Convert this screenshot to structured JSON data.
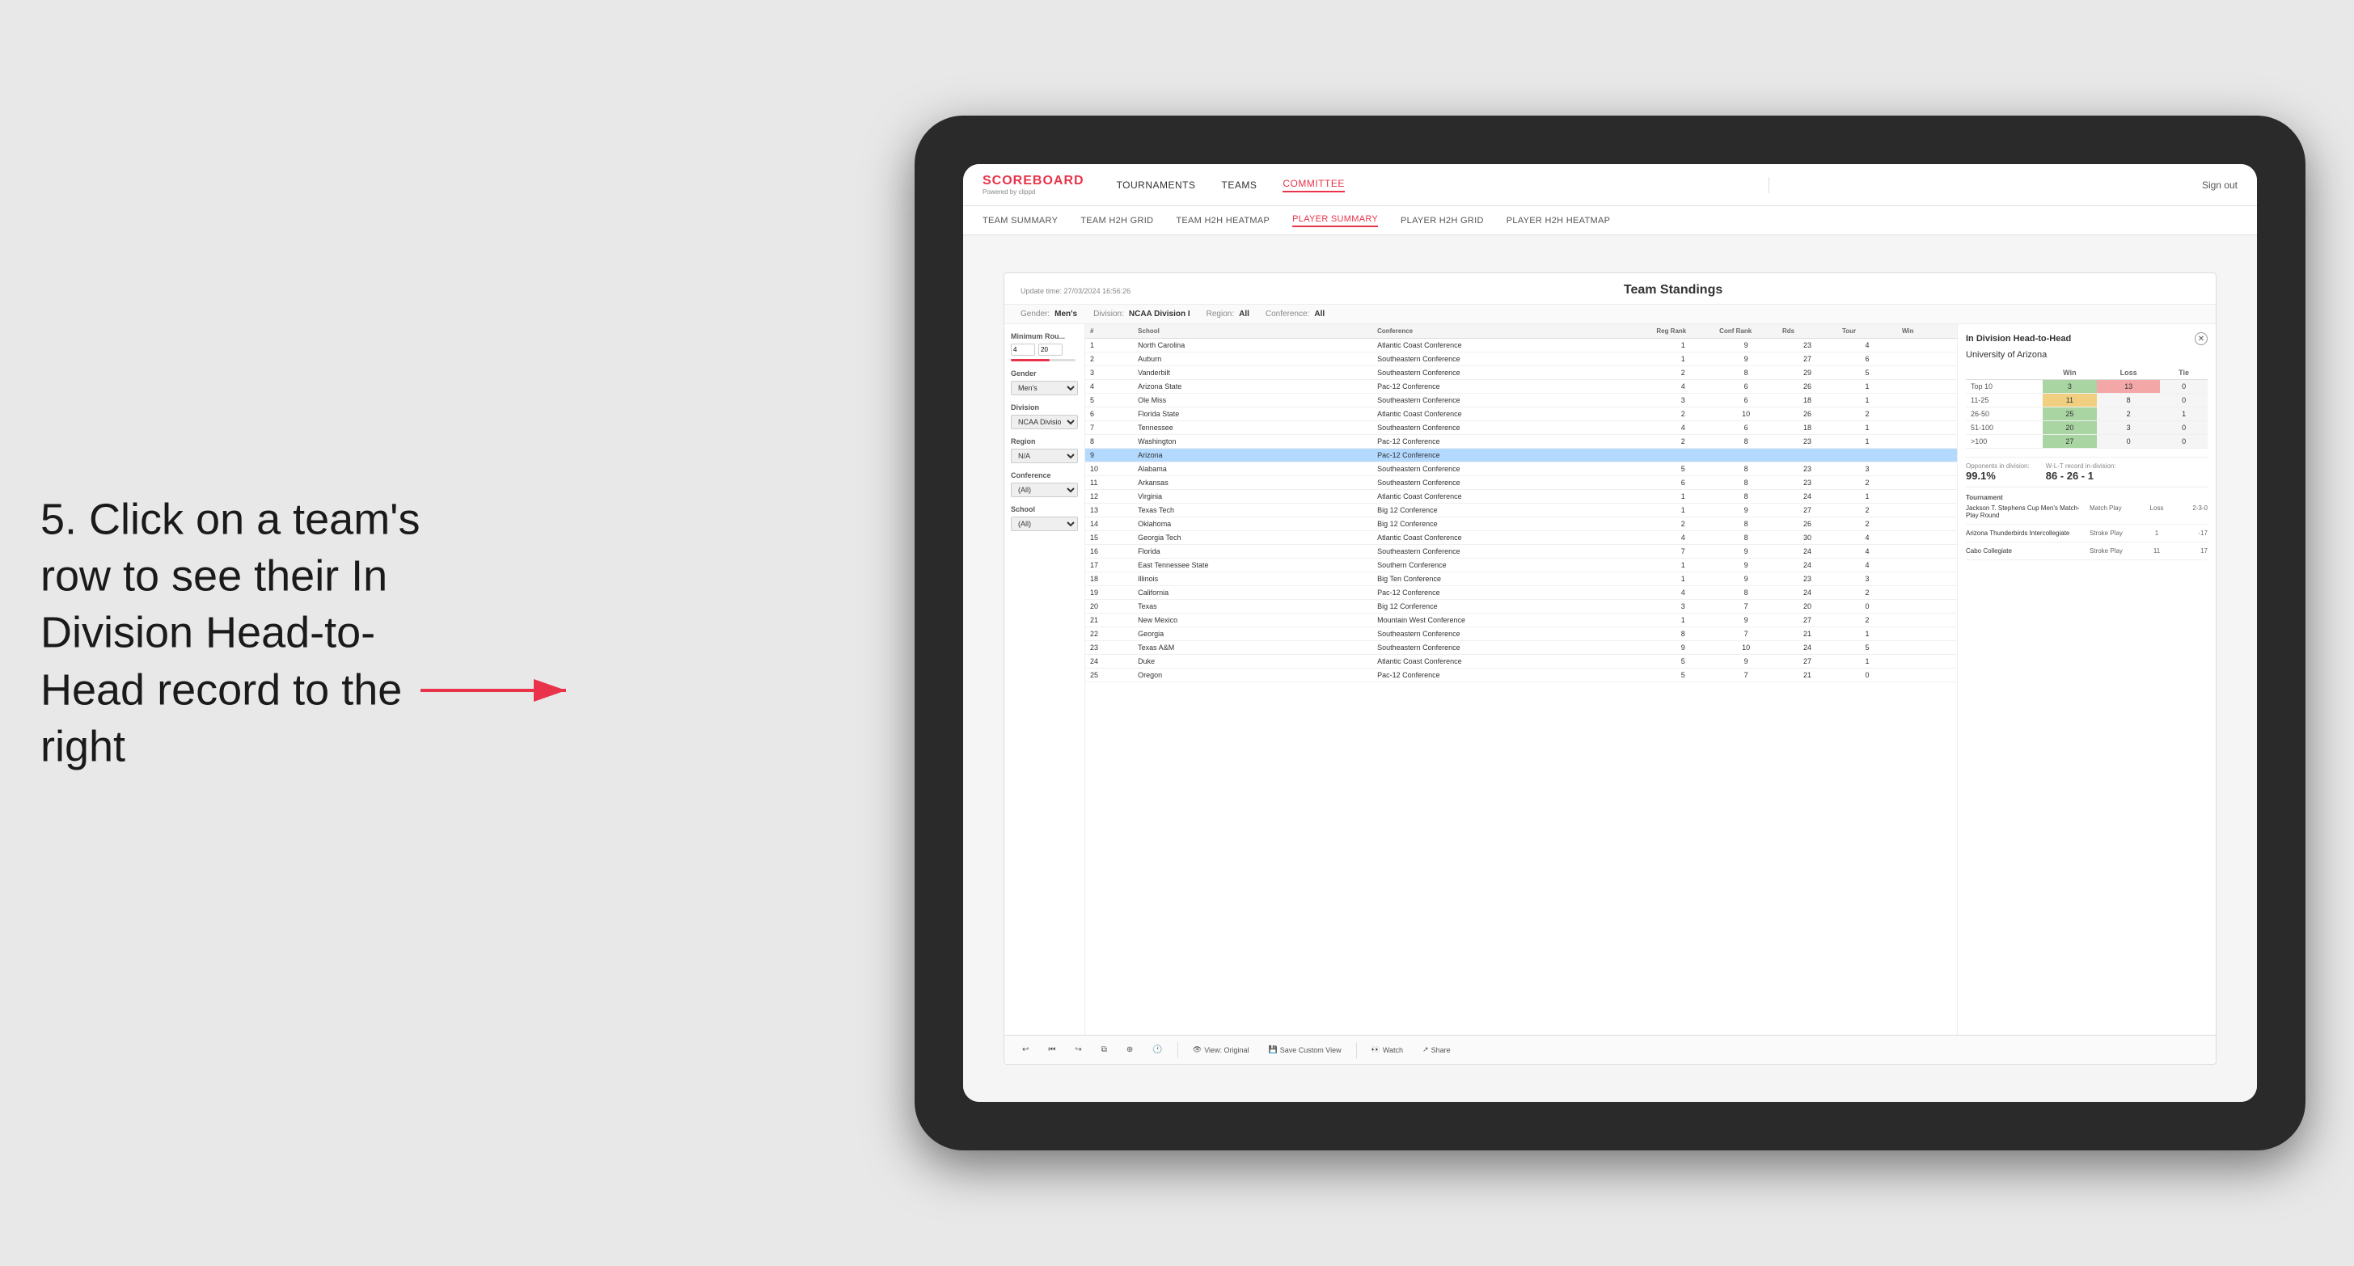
{
  "instruction": {
    "text": "5. Click on a team's row to see their In Division Head-to-Head record to the right"
  },
  "nav": {
    "logo": "SCOREBOARD",
    "logo_sub": "Powered by clippd",
    "links": [
      "TOURNAMENTS",
      "TEAMS",
      "COMMITTEE"
    ],
    "active_link": "COMMITTEE",
    "sign_out": "Sign out"
  },
  "sub_nav": {
    "links": [
      "TEAM SUMMARY",
      "TEAM H2H GRID",
      "TEAM H2H HEATMAP",
      "PLAYER SUMMARY",
      "PLAYER H2H GRID",
      "PLAYER H2H HEATMAP"
    ],
    "active": "PLAYER SUMMARY"
  },
  "dashboard": {
    "update_time": "Update time: 27/03/2024 16:56:26",
    "title": "Team Standings",
    "filters": {
      "gender": "Men's",
      "division": "NCAA Division I",
      "region": "All",
      "conference": "All"
    }
  },
  "sidebar": {
    "min_rounds_label": "Minimum Rou...",
    "min_rounds_value": "4",
    "min_rounds_max": "20",
    "gender_label": "Gender",
    "gender_value": "Men's",
    "division_label": "Division",
    "division_value": "NCAA Division I",
    "region_label": "Region",
    "region_value": "N/A",
    "conference_label": "Conference",
    "conference_value": "(All)",
    "school_label": "School",
    "school_value": "(All)"
  },
  "table": {
    "headers": [
      "#",
      "School",
      "Conference",
      "Reg Rank",
      "Conf Rank",
      "Rds",
      "Tour",
      "Win"
    ],
    "rows": [
      {
        "rank": 1,
        "school": "North Carolina",
        "conference": "Atlantic Coast Conference",
        "reg_rank": 1,
        "conf_rank": 9,
        "rds": 23,
        "tour": 4,
        "win": ""
      },
      {
        "rank": 2,
        "school": "Auburn",
        "conference": "Southeastern Conference",
        "reg_rank": 1,
        "conf_rank": 9,
        "rds": 27,
        "tour": 6,
        "win": ""
      },
      {
        "rank": 3,
        "school": "Vanderbilt",
        "conference": "Southeastern Conference",
        "reg_rank": 2,
        "conf_rank": 8,
        "rds": 29,
        "tour": 5,
        "win": ""
      },
      {
        "rank": 4,
        "school": "Arizona State",
        "conference": "Pac-12 Conference",
        "reg_rank": 4,
        "conf_rank": 6,
        "rds": 26,
        "tour": 1,
        "win": ""
      },
      {
        "rank": 5,
        "school": "Ole Miss",
        "conference": "Southeastern Conference",
        "reg_rank": 3,
        "conf_rank": 6,
        "rds": 18,
        "tour": 1,
        "win": ""
      },
      {
        "rank": 6,
        "school": "Florida State",
        "conference": "Atlantic Coast Conference",
        "reg_rank": 2,
        "conf_rank": 10,
        "rds": 26,
        "tour": 2,
        "win": ""
      },
      {
        "rank": 7,
        "school": "Tennessee",
        "conference": "Southeastern Conference",
        "reg_rank": 4,
        "conf_rank": 6,
        "rds": 18,
        "tour": 1,
        "win": ""
      },
      {
        "rank": 8,
        "school": "Washington",
        "conference": "Pac-12 Conference",
        "reg_rank": 2,
        "conf_rank": 8,
        "rds": 23,
        "tour": 1,
        "win": ""
      },
      {
        "rank": 9,
        "school": "Arizona",
        "conference": "Pac-12 Conference",
        "reg_rank": "",
        "conf_rank": "",
        "rds": "",
        "tour": "",
        "win": "",
        "highlighted": true
      },
      {
        "rank": 10,
        "school": "Alabama",
        "conference": "Southeastern Conference",
        "reg_rank": 5,
        "conf_rank": 8,
        "rds": 23,
        "tour": 3,
        "win": ""
      },
      {
        "rank": 11,
        "school": "Arkansas",
        "conference": "Southeastern Conference",
        "reg_rank": 6,
        "conf_rank": 8,
        "rds": 23,
        "tour": 2,
        "win": ""
      },
      {
        "rank": 12,
        "school": "Virginia",
        "conference": "Atlantic Coast Conference",
        "reg_rank": 1,
        "conf_rank": 8,
        "rds": 24,
        "tour": 1,
        "win": ""
      },
      {
        "rank": 13,
        "school": "Texas Tech",
        "conference": "Big 12 Conference",
        "reg_rank": 1,
        "conf_rank": 9,
        "rds": 27,
        "tour": 2,
        "win": ""
      },
      {
        "rank": 14,
        "school": "Oklahoma",
        "conference": "Big 12 Conference",
        "reg_rank": 2,
        "conf_rank": 8,
        "rds": 26,
        "tour": 2,
        "win": ""
      },
      {
        "rank": 15,
        "school": "Georgia Tech",
        "conference": "Atlantic Coast Conference",
        "reg_rank": 4,
        "conf_rank": 8,
        "rds": 30,
        "tour": 4,
        "win": ""
      },
      {
        "rank": 16,
        "school": "Florida",
        "conference": "Southeastern Conference",
        "reg_rank": 7,
        "conf_rank": 9,
        "rds": 24,
        "tour": 4,
        "win": ""
      },
      {
        "rank": 17,
        "school": "East Tennessee State",
        "conference": "Southern Conference",
        "reg_rank": 1,
        "conf_rank": 9,
        "rds": 24,
        "tour": 4,
        "win": ""
      },
      {
        "rank": 18,
        "school": "Illinois",
        "conference": "Big Ten Conference",
        "reg_rank": 1,
        "conf_rank": 9,
        "rds": 23,
        "tour": 3,
        "win": ""
      },
      {
        "rank": 19,
        "school": "California",
        "conference": "Pac-12 Conference",
        "reg_rank": 4,
        "conf_rank": 8,
        "rds": 24,
        "tour": 2,
        "win": ""
      },
      {
        "rank": 20,
        "school": "Texas",
        "conference": "Big 12 Conference",
        "reg_rank": 3,
        "conf_rank": 7,
        "rds": 20,
        "tour": 0,
        "win": ""
      },
      {
        "rank": 21,
        "school": "New Mexico",
        "conference": "Mountain West Conference",
        "reg_rank": 1,
        "conf_rank": 9,
        "rds": 27,
        "tour": 2,
        "win": ""
      },
      {
        "rank": 22,
        "school": "Georgia",
        "conference": "Southeastern Conference",
        "reg_rank": 8,
        "conf_rank": 7,
        "rds": 21,
        "tour": 1,
        "win": ""
      },
      {
        "rank": 23,
        "school": "Texas A&M",
        "conference": "Southeastern Conference",
        "reg_rank": 9,
        "conf_rank": 10,
        "rds": 24,
        "tour": 5,
        "win": ""
      },
      {
        "rank": 24,
        "school": "Duke",
        "conference": "Atlantic Coast Conference",
        "reg_rank": 5,
        "conf_rank": 9,
        "rds": 27,
        "tour": 1,
        "win": ""
      },
      {
        "rank": 25,
        "school": "Oregon",
        "conference": "Pac-12 Conference",
        "reg_rank": 5,
        "conf_rank": 7,
        "rds": 21,
        "tour": 0,
        "win": ""
      }
    ]
  },
  "h2h": {
    "title": "In Division Head-to-Head",
    "team": "University of Arizona",
    "headers": [
      "",
      "Win",
      "Loss",
      "Tie"
    ],
    "rows": [
      {
        "label": "Top 10",
        "win": 3,
        "loss": 13,
        "tie": 0,
        "win_color": "green",
        "loss_color": "red"
      },
      {
        "label": "11-25",
        "win": 11,
        "loss": 8,
        "tie": 0,
        "win_color": "yellow",
        "loss_color": "light"
      },
      {
        "label": "26-50",
        "win": 25,
        "loss": 2,
        "tie": 1,
        "win_color": "green2",
        "loss_color": "light"
      },
      {
        "label": "51-100",
        "win": 20,
        "loss": 3,
        "tie": 0,
        "win_color": "green2",
        "loss_color": "light"
      },
      {
        "label": ">100",
        "win": 27,
        "loss": 0,
        "tie": 0,
        "win_color": "green2",
        "loss_color": "light"
      }
    ],
    "opponents_label": "Opponents in division:",
    "opponents_value": "99.1%",
    "record_label": "W-L-T record in-division:",
    "record_value": "86 - 26 - 1",
    "tournaments": [
      {
        "name": "Jackson T. Stephens Cup Men's Match-Play Round",
        "type": "Match Play",
        "pos": "Loss",
        "score": "2-3-0"
      },
      {
        "name": "Arizona Thunderbirds Intercollegiate",
        "type": "Stroke Play",
        "pos": "1",
        "score": "-17"
      },
      {
        "name": "Cabo Collegiate",
        "type": "Stroke Play",
        "pos": "11",
        "score": "17"
      }
    ]
  },
  "toolbar": {
    "undo": "↩",
    "redo": "↪",
    "view_original": "View: Original",
    "save_custom": "Save Custom View",
    "watch": "Watch",
    "share": "Share"
  }
}
